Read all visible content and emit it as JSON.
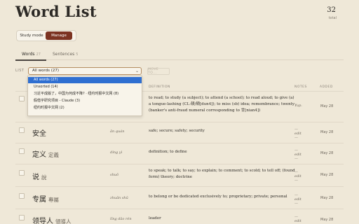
{
  "header": {
    "title": "Word List",
    "total_count": "32",
    "total_label": "total"
  },
  "mode": {
    "study_label": "Study mode",
    "manage_label": "Manage"
  },
  "tabs": [
    {
      "label": "Words",
      "count": "27"
    },
    {
      "label": "Sentences",
      "count": "5"
    }
  ],
  "toolbar": {
    "list_label": "LIST",
    "selected_list": "All words (27)",
    "move_label": "MOVE TO..."
  },
  "dropdown": {
    "options": [
      "All words (27)",
      "Unsorted (14)",
      "习近平成版了，中国为何成不降? · 纽约时报中文网 (8)",
      "假借字研究项目 - Claude (3)",
      "纽约时报中文网 (2)"
    ]
  },
  "columns": {
    "definition": "DEFINITION",
    "notes": "NOTES",
    "added": "ADDED"
  },
  "rows": [
    {
      "term": "",
      "trad": "",
      "pinyin": "",
      "definition": "to read; to study (a subject); to attend (a school); to read aloud; to give (a) a tongue-lashing (CL:顿/顿[dun4]); to miss (sb) idea; remembrance; twenty (banker's anti-fraud numeral corresponding to 廿[nian4])",
      "note": "Yup.",
      "added": "May 28"
    },
    {
      "term": "安全",
      "trad": "",
      "pinyin": "ān quán",
      "definition": "safe; secure; safety; security",
      "note": "— edit —",
      "added": "May 28"
    },
    {
      "term": "定义",
      "trad": "定義",
      "pinyin": "dìng yì",
      "definition": "definition; to define",
      "note": "— edit —",
      "added": "May 28"
    },
    {
      "term": "说",
      "trad": "說",
      "pinyin": "shuō",
      "definition": "to speak; to talk; to say; to explain; to comment; to scold; to tell off; (found form) theory; doctrine",
      "note": "— edit —",
      "added": "May 28"
    },
    {
      "term": "专属",
      "trad": "專屬",
      "pinyin": "zhuān shǔ",
      "definition": "to belong or be dedicated exclusively to; proprietary; private; personal",
      "note": "— edit —",
      "added": "May 28"
    },
    {
      "term": "领导人",
      "trad": "領導人",
      "pinyin": "lǐng dǎo rén",
      "definition": "leader",
      "note": "— edit —",
      "added": "May 28"
    }
  ]
}
